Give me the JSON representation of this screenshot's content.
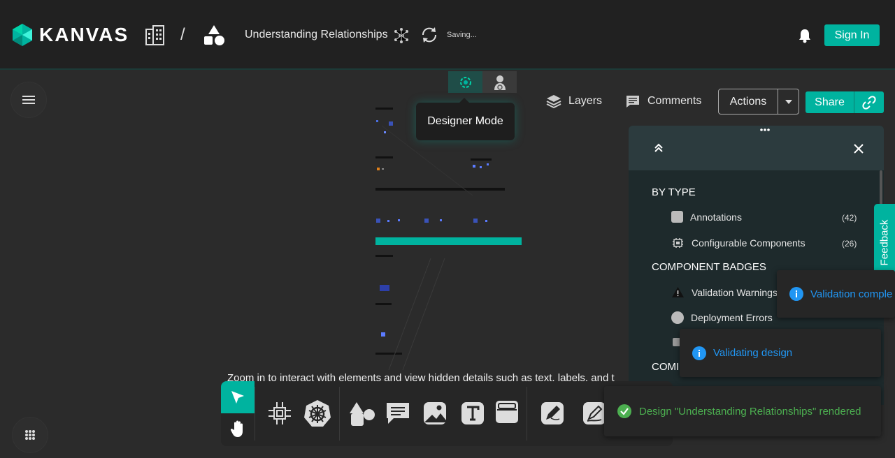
{
  "app": {
    "name": "KANVAS"
  },
  "header": {
    "design_title": "Understanding Relationships",
    "status": "Saving...",
    "breadcrumb_separator": "/",
    "sign_in_label": "Sign In"
  },
  "mode": {
    "tooltip": "Designer Mode",
    "tabs": [
      {
        "icon": "designer-mode-icon",
        "active": true
      },
      {
        "icon": "operator-mode-icon",
        "active": false
      }
    ]
  },
  "toolbar": {
    "layers_label": "Layers",
    "comments_label": "Comments",
    "actions_label": "Actions",
    "share_label": "Share"
  },
  "panel": {
    "by_type_heading": "BY TYPE",
    "by_type": [
      {
        "label": "Annotations",
        "count": "(42)",
        "icon": "annotation-icon"
      },
      {
        "label": "Configurable Components",
        "count": "(26)",
        "icon": "component-icon"
      }
    ],
    "badges_heading": "COMPONENT BADGES",
    "badges": [
      {
        "label": "Validation Warnings",
        "icon": "warning-icon"
      },
      {
        "label": "Deployment Errors",
        "icon": "error-icon"
      }
    ],
    "third_heading": "COMI"
  },
  "feedback_label": "Feedback",
  "toasts": {
    "validation_complete": "Validation comple",
    "validating": "Validating design",
    "rendered": "Design \"Understanding Relationships\" rendered"
  },
  "zoom_hint": "Zoom in to interact with elements and view hidden details such as text, labels, and t",
  "colors": {
    "accent": "#00b39f",
    "info": "#2196f3",
    "success": "#4caf50"
  }
}
